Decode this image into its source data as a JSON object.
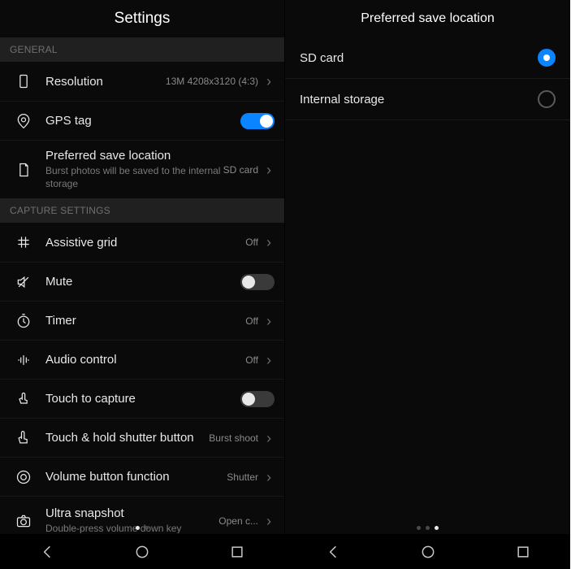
{
  "left": {
    "title": "Settings",
    "sections": {
      "general": {
        "header": "GENERAL",
        "resolution": {
          "label": "Resolution",
          "value": "13M 4208x3120 (4:3)"
        },
        "gps_tag": {
          "label": "GPS tag",
          "on": true
        },
        "preferred_save": {
          "label": "Preferred save location",
          "sub": "Burst photos will be saved to the internal storage",
          "value": "SD card"
        }
      },
      "capture": {
        "header": "CAPTURE SETTINGS",
        "assistive_grid": {
          "label": "Assistive grid",
          "value": "Off"
        },
        "mute": {
          "label": "Mute",
          "on": false
        },
        "timer": {
          "label": "Timer",
          "value": "Off"
        },
        "audio_control": {
          "label": "Audio control",
          "value": "Off"
        },
        "touch_capture": {
          "label": "Touch to capture",
          "on": false
        },
        "touch_hold": {
          "label": "Touch & hold shutter button",
          "value": "Burst shoot"
        },
        "volume_btn": {
          "label": "Volume button function",
          "value": "Shutter"
        },
        "ultra_snapshot": {
          "label": "Ultra snapshot",
          "sub": "Double-press volume down key",
          "value": "Open c..."
        }
      }
    }
  },
  "right": {
    "title": "Preferred save location",
    "options": {
      "sd_card": {
        "label": "SD card",
        "selected": true
      },
      "internal": {
        "label": "Internal storage",
        "selected": false
      }
    }
  }
}
